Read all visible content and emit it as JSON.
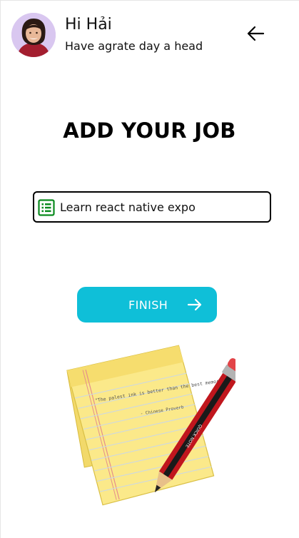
{
  "header": {
    "greeting": "Hi Hải",
    "subtitle": "Have agrate day a head"
  },
  "main": {
    "title": "ADD YOUR JOB",
    "job_input_value": "Learn react native expo",
    "finish_label": "FINISH"
  },
  "illustration": {
    "quote": "\"The palest ink is better than the best memory.\"",
    "quote_source": "- Chinese Proverb",
    "pencil_text": "QUICK NOTE"
  },
  "colors": {
    "finish_button": "#0fbfd8",
    "list_icon": "#0a8a1e",
    "avatar_bg": "#d9c7f0"
  },
  "icons": {
    "back": "arrow-left-icon",
    "job_field": "list-icon",
    "finish": "arrow-right-icon"
  }
}
